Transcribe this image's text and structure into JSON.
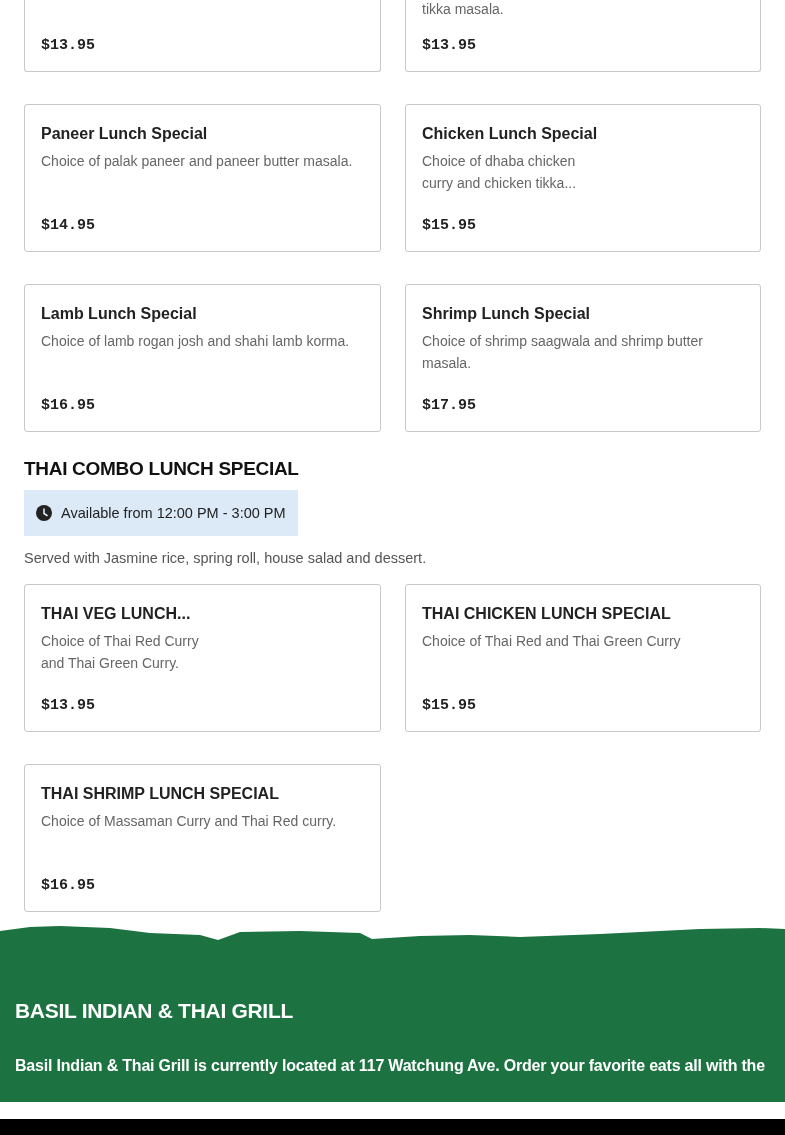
{
  "top_cards": [
    {
      "price": "$13.95"
    },
    {
      "description_lines": [
        "tikka masala."
      ],
      "price": "$13.95"
    }
  ],
  "sections": [
    {
      "cards": [
        {
          "title": "Paneer Lunch Special",
          "description_lines": [
            "Choice of palak paneer and paneer butter masala."
          ],
          "price": "$14.95"
        },
        {
          "title": "Chicken Lunch Special",
          "description_lines": [
            "Choice of dhaba chicken",
            "curry and chicken tikka..."
          ],
          "price": "$15.95"
        },
        {
          "title": "Lamb Lunch Special",
          "description_lines": [
            "Choice of lamb rogan josh and shahi lamb korma."
          ],
          "price": "$16.95"
        },
        {
          "title": "Shrimp Lunch Special",
          "description_lines": [
            "Choice of shrimp saagwala and shrimp butter",
            "masala."
          ],
          "price": "$17.95"
        }
      ]
    },
    {
      "heading": "THAI COMBO LUNCH SPECIAL",
      "availability": "Available from 12:00 PM - 3:00 PM",
      "note": "Served with Jasmine rice, spring roll, house salad and dessert.",
      "cards": [
        {
          "title": "THAI VEG LUNCH...",
          "description_lines": [
            "Choice of Thai Red Curry",
            "and Thai Green Curry."
          ],
          "price": "$13.95"
        },
        {
          "title": "THAI CHICKEN LUNCH SPECIAL",
          "description_lines": [
            "Choice of Thai Red and Thai Green Curry"
          ],
          "price": "$15.95"
        },
        {
          "title": "THAI SHRIMP LUNCH SPECIAL",
          "description_lines": [
            "Choice of Massaman Curry and Thai Red curry."
          ],
          "price": "$16.95"
        }
      ]
    }
  ],
  "footer": {
    "title": "BASIL INDIAN & THAI GRILL",
    "text": "Basil Indian & Thai Grill is currently located at 117 Watchung Ave. Order your favorite eats all with the"
  }
}
